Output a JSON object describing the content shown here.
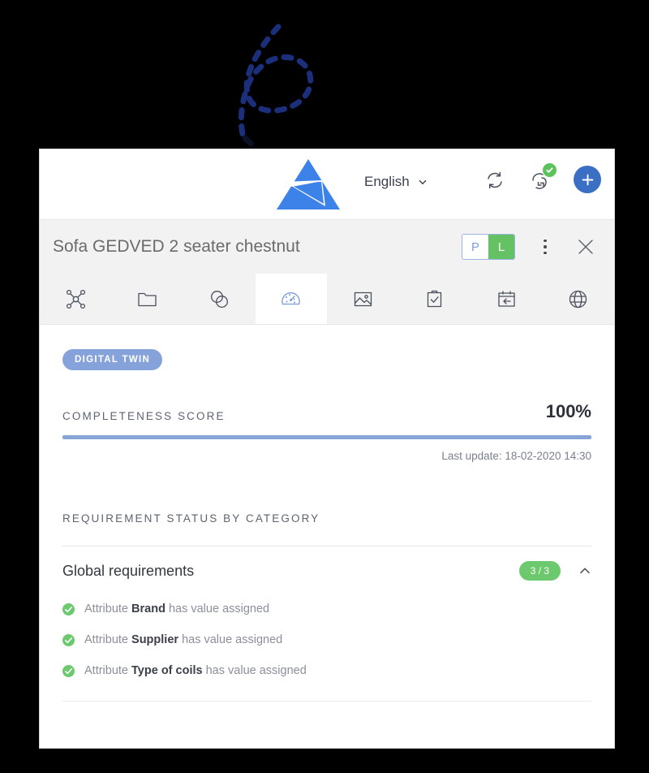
{
  "annotation": {
    "name": "dashed-swirl-arrow",
    "color": "#1b2f7a",
    "target": "brand-logo"
  },
  "colors": {
    "accent_blue": "#3b6fc4",
    "progress_blue": "#86a5d6",
    "pill_blue": "#85a2da",
    "green": "#64c264",
    "badge_green": "#6dc96d",
    "title_gray": "#6b6b6b",
    "window_bg": "#ffffff",
    "chrome_gray": "#f2f2f2",
    "page_bg": "#000000"
  },
  "appbar": {
    "logo_name": "brand-logo",
    "language": {
      "label": "English",
      "chevron": "chevron-down-icon"
    },
    "actions": [
      {
        "name": "sync-icon",
        "label": "Sync",
        "badge": null
      },
      {
        "name": "sync-success-icon",
        "label": "Synchronized",
        "badge": "check-badge"
      },
      {
        "name": "add-button",
        "label": "+"
      }
    ]
  },
  "titlebar": {
    "title": "Sofa GEDVED 2 seater chestnut",
    "toggle": {
      "name": "pl-toggle",
      "options": [
        "P",
        "L"
      ],
      "selected": "L"
    },
    "more_label": "More options",
    "close_label": "Close"
  },
  "tabs": [
    {
      "name": "tab-structure",
      "icon": "nodes-network-icon",
      "active": false
    },
    {
      "name": "tab-folders",
      "icon": "folder-icon",
      "active": false
    },
    {
      "name": "tab-relations",
      "icon": "linked-circles-icon",
      "active": false
    },
    {
      "name": "tab-quality",
      "icon": "gauge-icon",
      "active": true
    },
    {
      "name": "tab-media",
      "icon": "image-icon",
      "active": false
    },
    {
      "name": "tab-tasks",
      "icon": "clipboard-check-icon",
      "active": false
    },
    {
      "name": "tab-schedule",
      "icon": "calendar-arrow-icon",
      "active": false
    },
    {
      "name": "tab-channels",
      "icon": "globe-icon",
      "active": false
    }
  ],
  "content": {
    "pill_label": "DIGITAL TWIN",
    "score": {
      "label": "COMPLETENESS SCORE",
      "value": "100%",
      "percent": 100,
      "last_update": "Last update: 18-02-2020 14:30"
    },
    "requirements": {
      "section_label": "REQUIREMENT STATUS BY CATEGORY",
      "category": {
        "name": "Global requirements",
        "count": "3 / 3",
        "expanded": true,
        "chevron": "chevron-up-icon"
      },
      "items": [
        {
          "icon": "check-circle-icon",
          "prefix": "Attribute ",
          "bold": "Brand",
          "suffix": " has value assigned"
        },
        {
          "icon": "check-circle-icon",
          "prefix": "Attribute ",
          "bold": "Supplier",
          "suffix": " has value assigned"
        },
        {
          "icon": "check-circle-icon",
          "prefix": "Attribute ",
          "bold": "Type of coils",
          "suffix": " has value assigned"
        }
      ]
    }
  }
}
